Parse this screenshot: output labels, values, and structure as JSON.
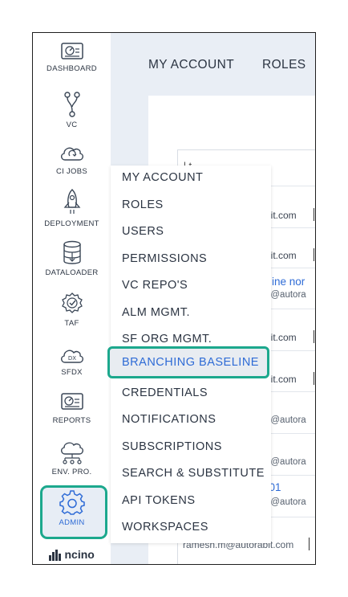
{
  "sidebar": {
    "items": [
      {
        "label": "DASHBOARD",
        "icon": "dashboard-icon"
      },
      {
        "label": "VC",
        "icon": "version-control-icon"
      },
      {
        "label": "CI JOBS",
        "icon": "ci-jobs-cloud-icon"
      },
      {
        "label": "DEPLOYMENT",
        "icon": "rocket-icon"
      },
      {
        "label": "DATALOADER",
        "icon": "database-icon"
      },
      {
        "label": "TAF",
        "icon": "taf-gear-check-icon"
      },
      {
        "label": "SFDX",
        "icon": "sfdx-cloud-icon"
      },
      {
        "label": "REPORTS",
        "icon": "reports-icon"
      },
      {
        "label": "ENV. PRO.",
        "icon": "env-cloud-icon"
      },
      {
        "label": "ADMIN",
        "icon": "gear-icon"
      }
    ],
    "logo_text": "ncino"
  },
  "top_tabs": [
    "MY ACCOUNT",
    "ROLES"
  ],
  "background": {
    "partial_header": "l    t",
    "emails": [
      "bit.com",
      "bit.com",
      "ine nor",
      "ri@autora",
      "bit.com",
      "bit.com",
      "ri@autora",
      "ri@autora",
      "001",
      "ri@autora",
      "ramesh.m@autorabit.com"
    ]
  },
  "admin_menu": {
    "items": [
      "MY ACCOUNT",
      "ROLES",
      "USERS",
      "PERMISSIONS",
      "VC REPO'S",
      "ALM MGMT.",
      "SF ORG MGMT.",
      "BRANCHING BASELINE",
      "CREDENTIALS",
      "NOTIFICATIONS",
      "SUBSCRIPTIONS",
      "SEARCH & SUBSTITUTE",
      "API TOKENS",
      "WORKSPACES"
    ],
    "active_item": "BRANCHING BASELINE"
  },
  "colors": {
    "highlight": "#1ca88d",
    "active_text": "#2e6bd6",
    "text": "#2b3442"
  }
}
